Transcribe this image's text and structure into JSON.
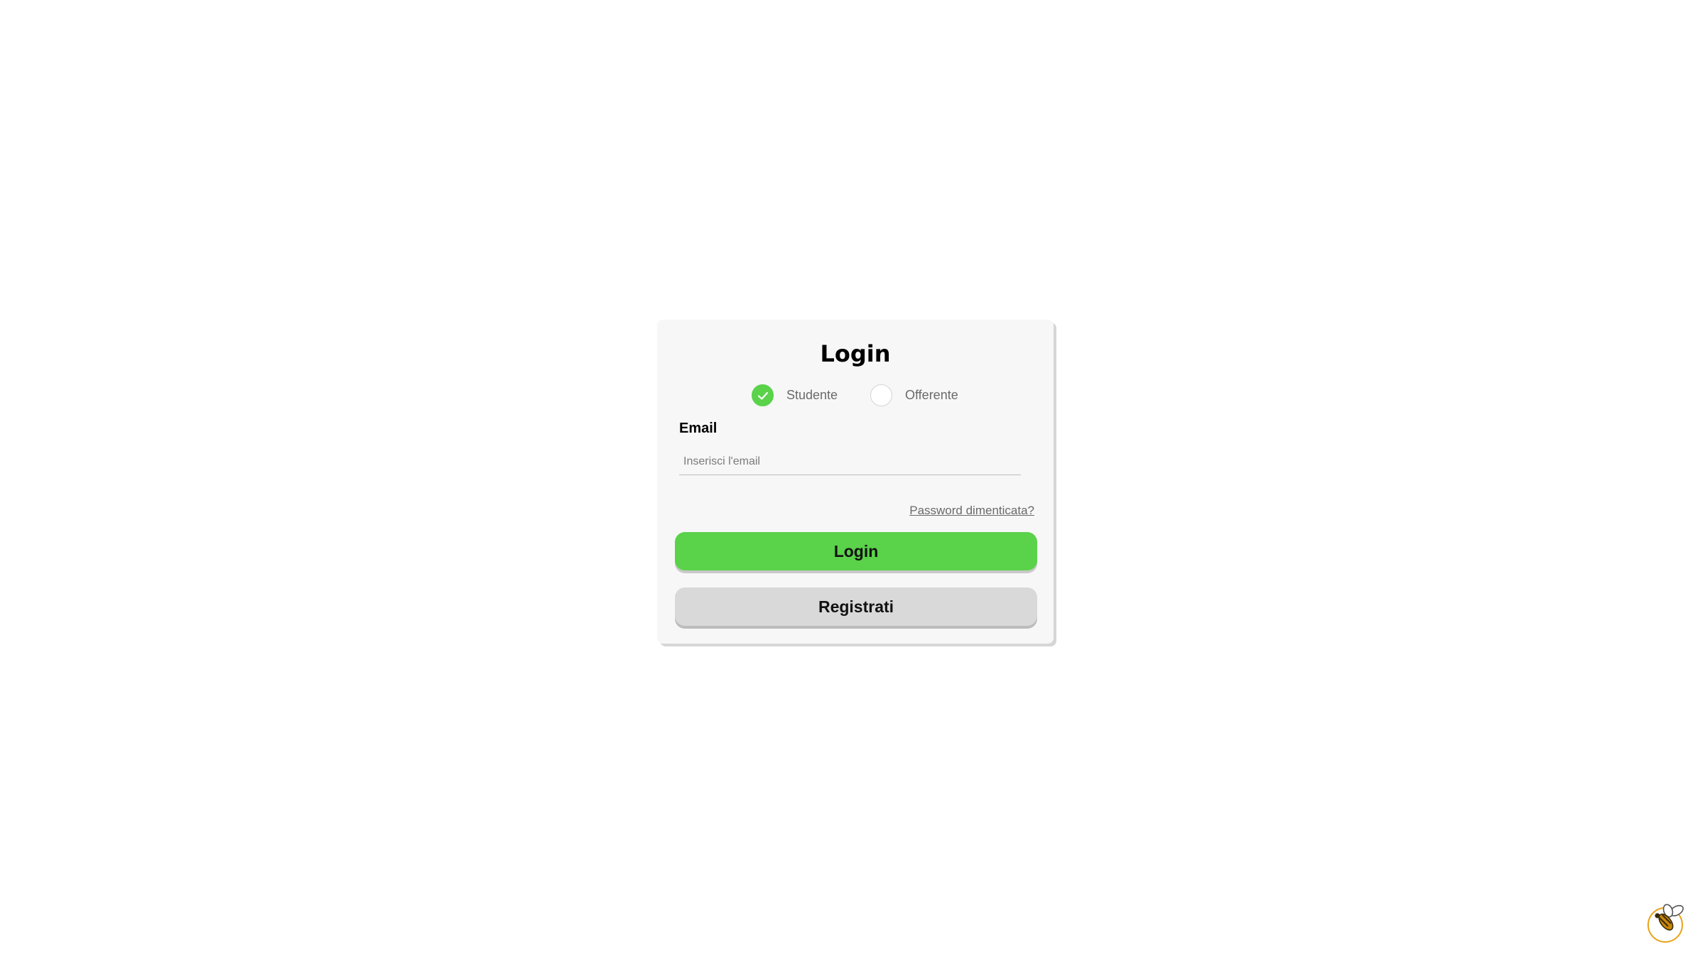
{
  "login": {
    "title": "Login",
    "roles": [
      {
        "label": "Studente",
        "selected": true
      },
      {
        "label": "Offerente",
        "selected": false
      }
    ],
    "email_label": "Email",
    "email_placeholder": "Inserisci l'email",
    "email_value": "",
    "forgot_password": "Password dimenticata?",
    "login_button": "Login",
    "register_button": "Registrati"
  },
  "colors": {
    "accent": "#5ad24a",
    "card_background": "#f7f7f7",
    "secondary_button": "#d9d9d9",
    "muted_text": "#6a6a6a"
  },
  "icons": {
    "selected_role": "checkmark-icon",
    "corner_logo": "bee-logo-icon"
  }
}
